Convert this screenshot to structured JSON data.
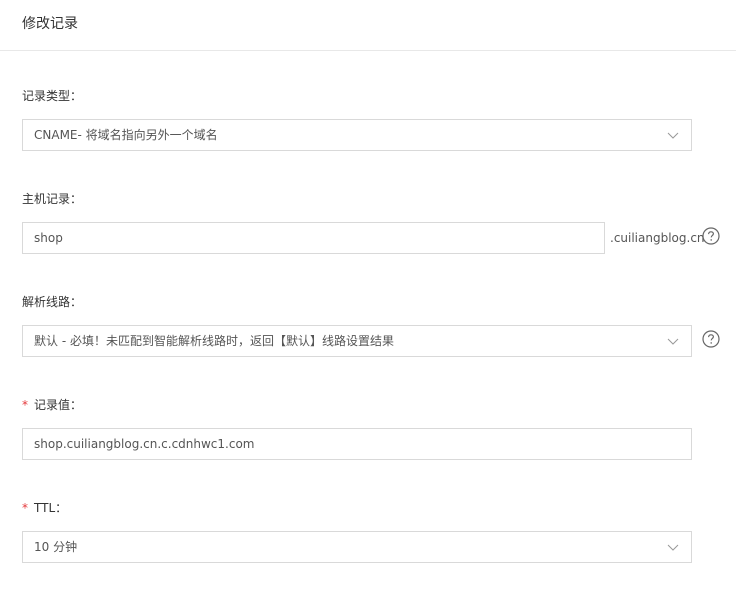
{
  "dialog": {
    "title": "修改记录"
  },
  "form": {
    "record_type": {
      "label": "记录类型：",
      "value": "CNAME- 将域名指向另外一个域名"
    },
    "host": {
      "label": "主机记录：",
      "value": "shop",
      "suffix": ".cuiliangblog.cn"
    },
    "line": {
      "label": "解析线路：",
      "value": "默认 - 必填！未匹配到智能解析线路时，返回【默认】线路设置结果"
    },
    "record_value": {
      "required_mark": "*",
      "label": "记录值：",
      "value": "shop.cuiliangblog.cn.c.cdnhwc1.com"
    },
    "ttl": {
      "required_mark": "*",
      "label": "TTL：",
      "value": "10 分钟"
    }
  },
  "icons": {
    "dropdown": "chevron-down-icon",
    "help": "question-circle-icon"
  },
  "colors": {
    "required": "#e4393c",
    "border": "#d9d9d9"
  }
}
